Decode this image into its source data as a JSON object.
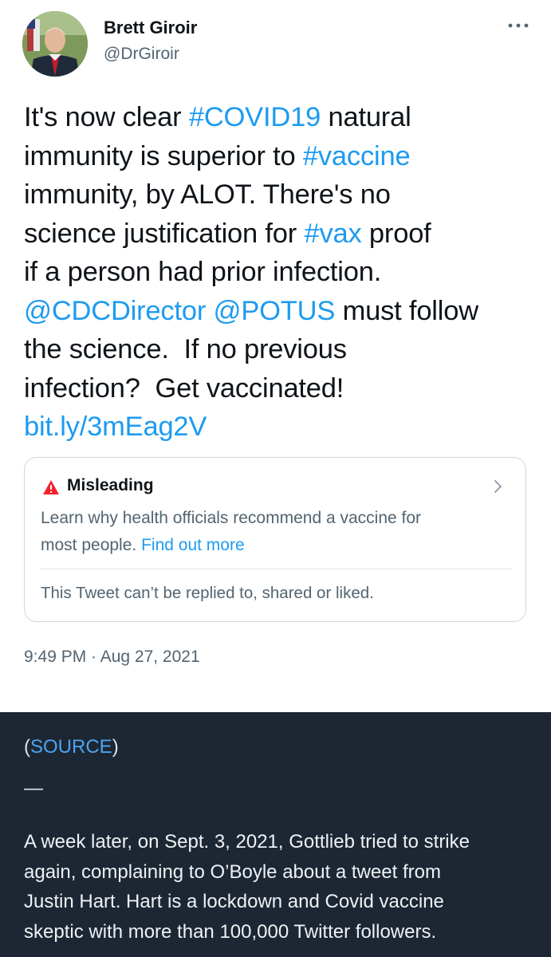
{
  "tweet": {
    "author_name": "Brett Giroir",
    "author_handle": "@DrGiroir",
    "lines": [
      [
        {
          "t": "It's now clear "
        },
        {
          "t": "#COVID19",
          "link": true
        },
        {
          "t": " natural"
        }
      ],
      [
        {
          "t": "immunity is superior to "
        },
        {
          "t": "#vaccine",
          "link": true
        }
      ],
      [
        {
          "t": "immunity, by ALOT. There's no"
        }
      ],
      [
        {
          "t": "science justification for "
        },
        {
          "t": "#vax",
          "link": true
        },
        {
          "t": " proof"
        }
      ],
      [
        {
          "t": "if a person had prior infection."
        }
      ],
      [
        {
          "t": "@CDCDirector",
          "link": true
        },
        {
          "t": " "
        },
        {
          "t": "@POTUS",
          "link": true
        },
        {
          "t": " must follow"
        }
      ],
      [
        {
          "t": "the science.  If no previous"
        }
      ],
      [
        {
          "t": "infection?  Get vaccinated!"
        }
      ],
      [
        {
          "t": "bit.ly/3mEag2V",
          "link": true
        }
      ]
    ],
    "timestamp": "9:49 PM · Aug 27, 2021"
  },
  "notice": {
    "title": "Misleading",
    "body_lines": [
      [
        {
          "t": "Learn why health officials recommend a vaccine for"
        }
      ],
      [
        {
          "t": "most people. "
        },
        {
          "t": "Find out more",
          "link": true
        }
      ]
    ],
    "footer": "This Tweet can’t be replied to, shared or liked."
  },
  "article": {
    "source_open": "(",
    "source_link": "SOURCE",
    "source_close": ")",
    "separator": "—",
    "paragraph_lines": [
      "A week later, on Sept. 3, 2021, Gottlieb tried to strike",
      "again, complaining to O’Boyle about a tweet from",
      "Justin Hart. Hart is a lockdown and Covid vaccine",
      "skeptic with more than 100,000 Twitter followers."
    ]
  },
  "icons": {
    "more": "more-horizontal-icon",
    "warning": "warning-triangle-icon",
    "chevron": "chevron-right-icon"
  },
  "colors": {
    "link": "#1d9bf0",
    "warning": "#f4212e",
    "article_background": "#1d2733",
    "source_link": "#4da3f2"
  }
}
